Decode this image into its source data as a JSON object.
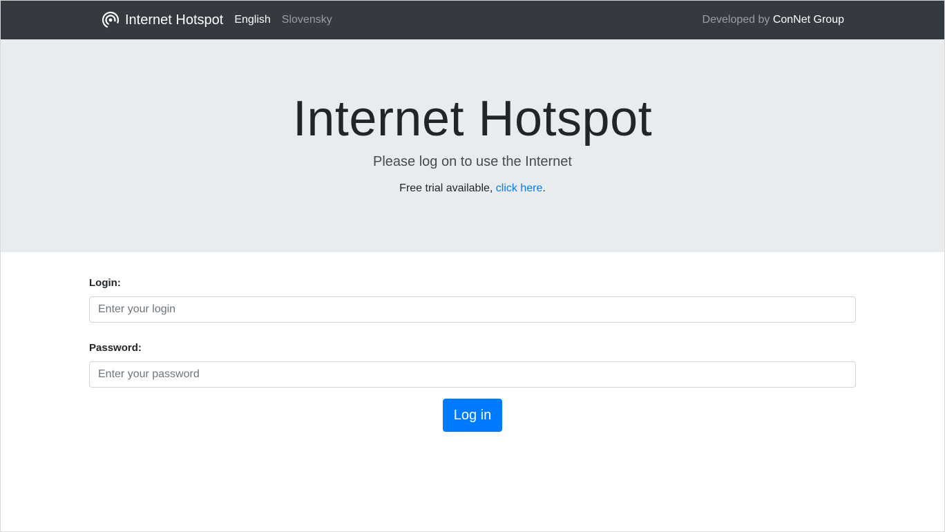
{
  "navbar": {
    "brand": "Internet Hotspot",
    "brand_icon": "wifi-hotspot-icon",
    "languages": [
      {
        "label": "English",
        "active": true
      },
      {
        "label": "Slovensky",
        "active": false
      }
    ],
    "developed_by_prefix": "Developed by",
    "developer": "ConNet Group"
  },
  "hero": {
    "title": "Internet Hotspot",
    "subtitle": "Please log on to use the Internet",
    "trial_text": "Free trial available,",
    "trial_link": "click here",
    "trial_suffix": "."
  },
  "form": {
    "login_label": "Login:",
    "login_placeholder": "Enter your login",
    "password_label": "Password:",
    "password_placeholder": "Enter your password",
    "submit_label": "Log in"
  },
  "colors": {
    "navbar_bg": "#343a40",
    "hero_bg": "#e9ecef",
    "primary": "#007bff"
  }
}
